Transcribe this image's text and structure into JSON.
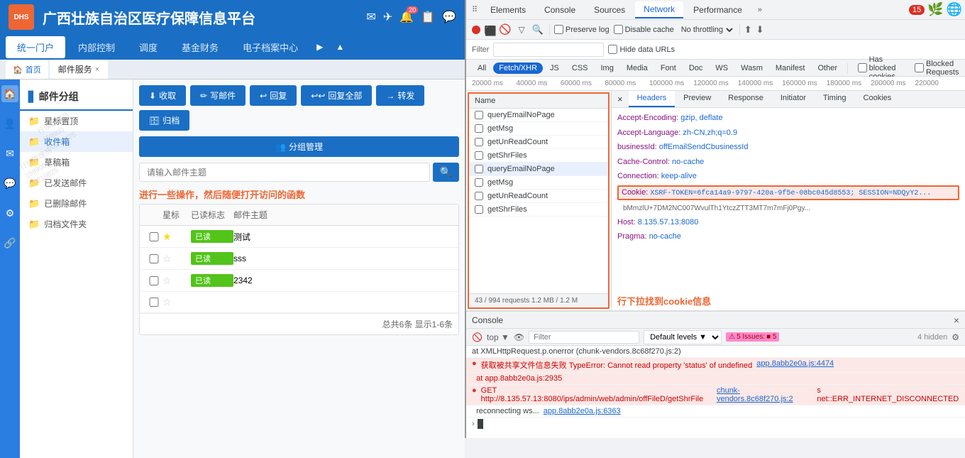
{
  "app": {
    "title": "广西壮族自治区医疗保障信息平台",
    "logo_text": "DHS",
    "badge_count": "20",
    "nav_items": [
      "统一门户",
      "内部控制",
      "调度",
      "基金财务",
      "电子档案中心"
    ],
    "tabs": [
      {
        "label": "首页",
        "icon": "🏠",
        "active": false
      },
      {
        "label": "邮件服务",
        "closeable": true,
        "active": true
      }
    ]
  },
  "mail": {
    "section_title": "邮件分组",
    "folders": [
      {
        "name": "星标置顶",
        "icon": "📁"
      },
      {
        "name": "收件箱",
        "icon": "📁",
        "active": true
      },
      {
        "name": "草稿箱",
        "icon": "📁"
      },
      {
        "name": "已发送邮件",
        "icon": "📁"
      },
      {
        "name": "已删除邮件",
        "icon": "📁"
      },
      {
        "name": "归档文件夹",
        "icon": "📁"
      }
    ],
    "actions": [
      {
        "label": "收取",
        "icon": "⬇",
        "color": "blue"
      },
      {
        "label": "写邮件",
        "icon": "✏",
        "color": "blue"
      },
      {
        "label": "回复",
        "icon": "↩",
        "color": "blue"
      },
      {
        "label": "回复全部",
        "icon": "↩↩",
        "color": "blue"
      },
      {
        "label": "转发",
        "icon": "→",
        "color": "blue"
      },
      {
        "label": "归档",
        "icon": "🗄",
        "color": "blue"
      }
    ],
    "group_mgmt_btn": "分组管理",
    "search_placeholder": "请输入邮件主题",
    "table_headers": [
      "星标",
      "已读标志",
      "邮件主题"
    ],
    "rows": [
      {
        "star": true,
        "read": true,
        "read_label": "已读",
        "subject": "测试"
      },
      {
        "star": false,
        "read": true,
        "read_label": "已读",
        "subject": "sss"
      },
      {
        "star": false,
        "read": true,
        "read_label": "已读",
        "subject": "2342"
      },
      {
        "star": false,
        "read": false,
        "read_label": "",
        "subject": ""
      }
    ],
    "footer": "总共6条 显示1-6条"
  },
  "annotation": {
    "arrow_text": "进行一些操作，然后随便打开访问的函数",
    "cookie_text": "行下拉找到cookie信息"
  },
  "devtools": {
    "tabs": [
      "Elements",
      "Console",
      "Sources",
      "Network",
      "Performance"
    ],
    "active_tab": "Network",
    "error_count": "15",
    "network": {
      "toolbar": {
        "preserve_log": "Preserve log",
        "disable_cache": "Disable cache",
        "no_throttling": "No throttling"
      },
      "filter_placeholder": "Filter",
      "hide_data_urls": "Hide data URLs",
      "type_tabs": [
        "All",
        "Fetch/XHR",
        "JS",
        "CSS",
        "Img",
        "Media",
        "Font",
        "Doc",
        "WS",
        "Wasm",
        "Manifest",
        "Other"
      ],
      "active_type": "Fetch/XHR",
      "has_blocked": "Has blocked cookies",
      "blocked_requests": "Blocked Requests",
      "timeline_labels": [
        "20000 ms",
        "40000 ms",
        "60000 ms",
        "80000 ms",
        "100000 ms",
        "120000 ms",
        "140000 ms",
        "160000 ms",
        "180000 ms",
        "200000 ms",
        "220000"
      ],
      "requests": [
        {
          "name": "queryEmailNoPage",
          "selected": false
        },
        {
          "name": "getMsg",
          "selected": false
        },
        {
          "name": "getUnReadCount",
          "selected": false
        },
        {
          "name": "getShrFiles",
          "selected": false
        },
        {
          "name": "queryEmailNoPage",
          "selected": true,
          "highlight": true
        },
        {
          "name": "getMsg",
          "selected": false
        },
        {
          "name": "getUnReadCount",
          "selected": false
        },
        {
          "name": "getShrFiles",
          "selected": false
        }
      ],
      "requests_summary": "43 / 994 requests  1.2 MB / 1.2 M",
      "headers_tabs": [
        "Headers",
        "Preview",
        "Response",
        "Initiator",
        "Timing",
        "Cookies"
      ],
      "active_headers_tab": "Headers",
      "headers": [
        {
          "name": "Accept-Encoding:",
          "value": "gzip, deflate"
        },
        {
          "name": "Accept-Language:",
          "value": "zh-CN,zh;q=0.9"
        },
        {
          "name": "businessId:",
          "value": "offEmailSendCbusinessId"
        },
        {
          "name": "Cache-Control:",
          "value": "no-cache"
        },
        {
          "name": "Connection:",
          "value": "keep-alive"
        },
        {
          "name": "Cookie:",
          "value": "XSRF-TOKEN=6fca14a9-9797-420a-9f5e-08bc045d8553; SESSION=NDQyY2...",
          "highlight": true
        },
        {
          "name": "",
          "value": "bMmzlU+7DM2NC007WvulTh1YtczZTT3MT7m7mFj0Pgy..."
        },
        {
          "name": "Host:",
          "value": "8.135.57.13:8080"
        },
        {
          "name": "Pragma:",
          "value": "no-cache"
        }
      ]
    },
    "console": {
      "title": "Console",
      "toolbar": {
        "filter_placeholder": "Filter",
        "levels": "Default levels ▼",
        "issues": "5 Issues:",
        "issues_count": "5",
        "hidden": "4 hidden"
      },
      "lines": [
        {
          "type": "normal",
          "text": "at XMLHttpRequest.p.onerror (chunk-vendors.8c68f270.js:2)"
        },
        {
          "type": "error",
          "text": "获取被共享文件信息失败 TypeError: Cannot read property 'status' of undefined",
          "link": "app.8abb2e0a.js:4474"
        },
        {
          "type": "error",
          "text": "  at app.8abb2e0a.js:2935"
        },
        {
          "type": "error",
          "text": "GET http://8.135.57.13:8080/ips/admin/web/admin/offFileD/getShrFile chunk-vendors.8c68f270.js:2\n s net::ERR_INTERNET_DISCONNECTED",
          "link": "chunk-vendors.8c68f270.js:2"
        },
        {
          "type": "normal",
          "text": "  reconnecting ws...",
          "link": "app.8abb2e0a.js:6363"
        }
      ]
    }
  },
  "watermarks": [
    {
      "text": "行续管理员\n159900\n20210825"
    },
    {
      "text": "行续管理员\n159900\n20210825"
    }
  ]
}
